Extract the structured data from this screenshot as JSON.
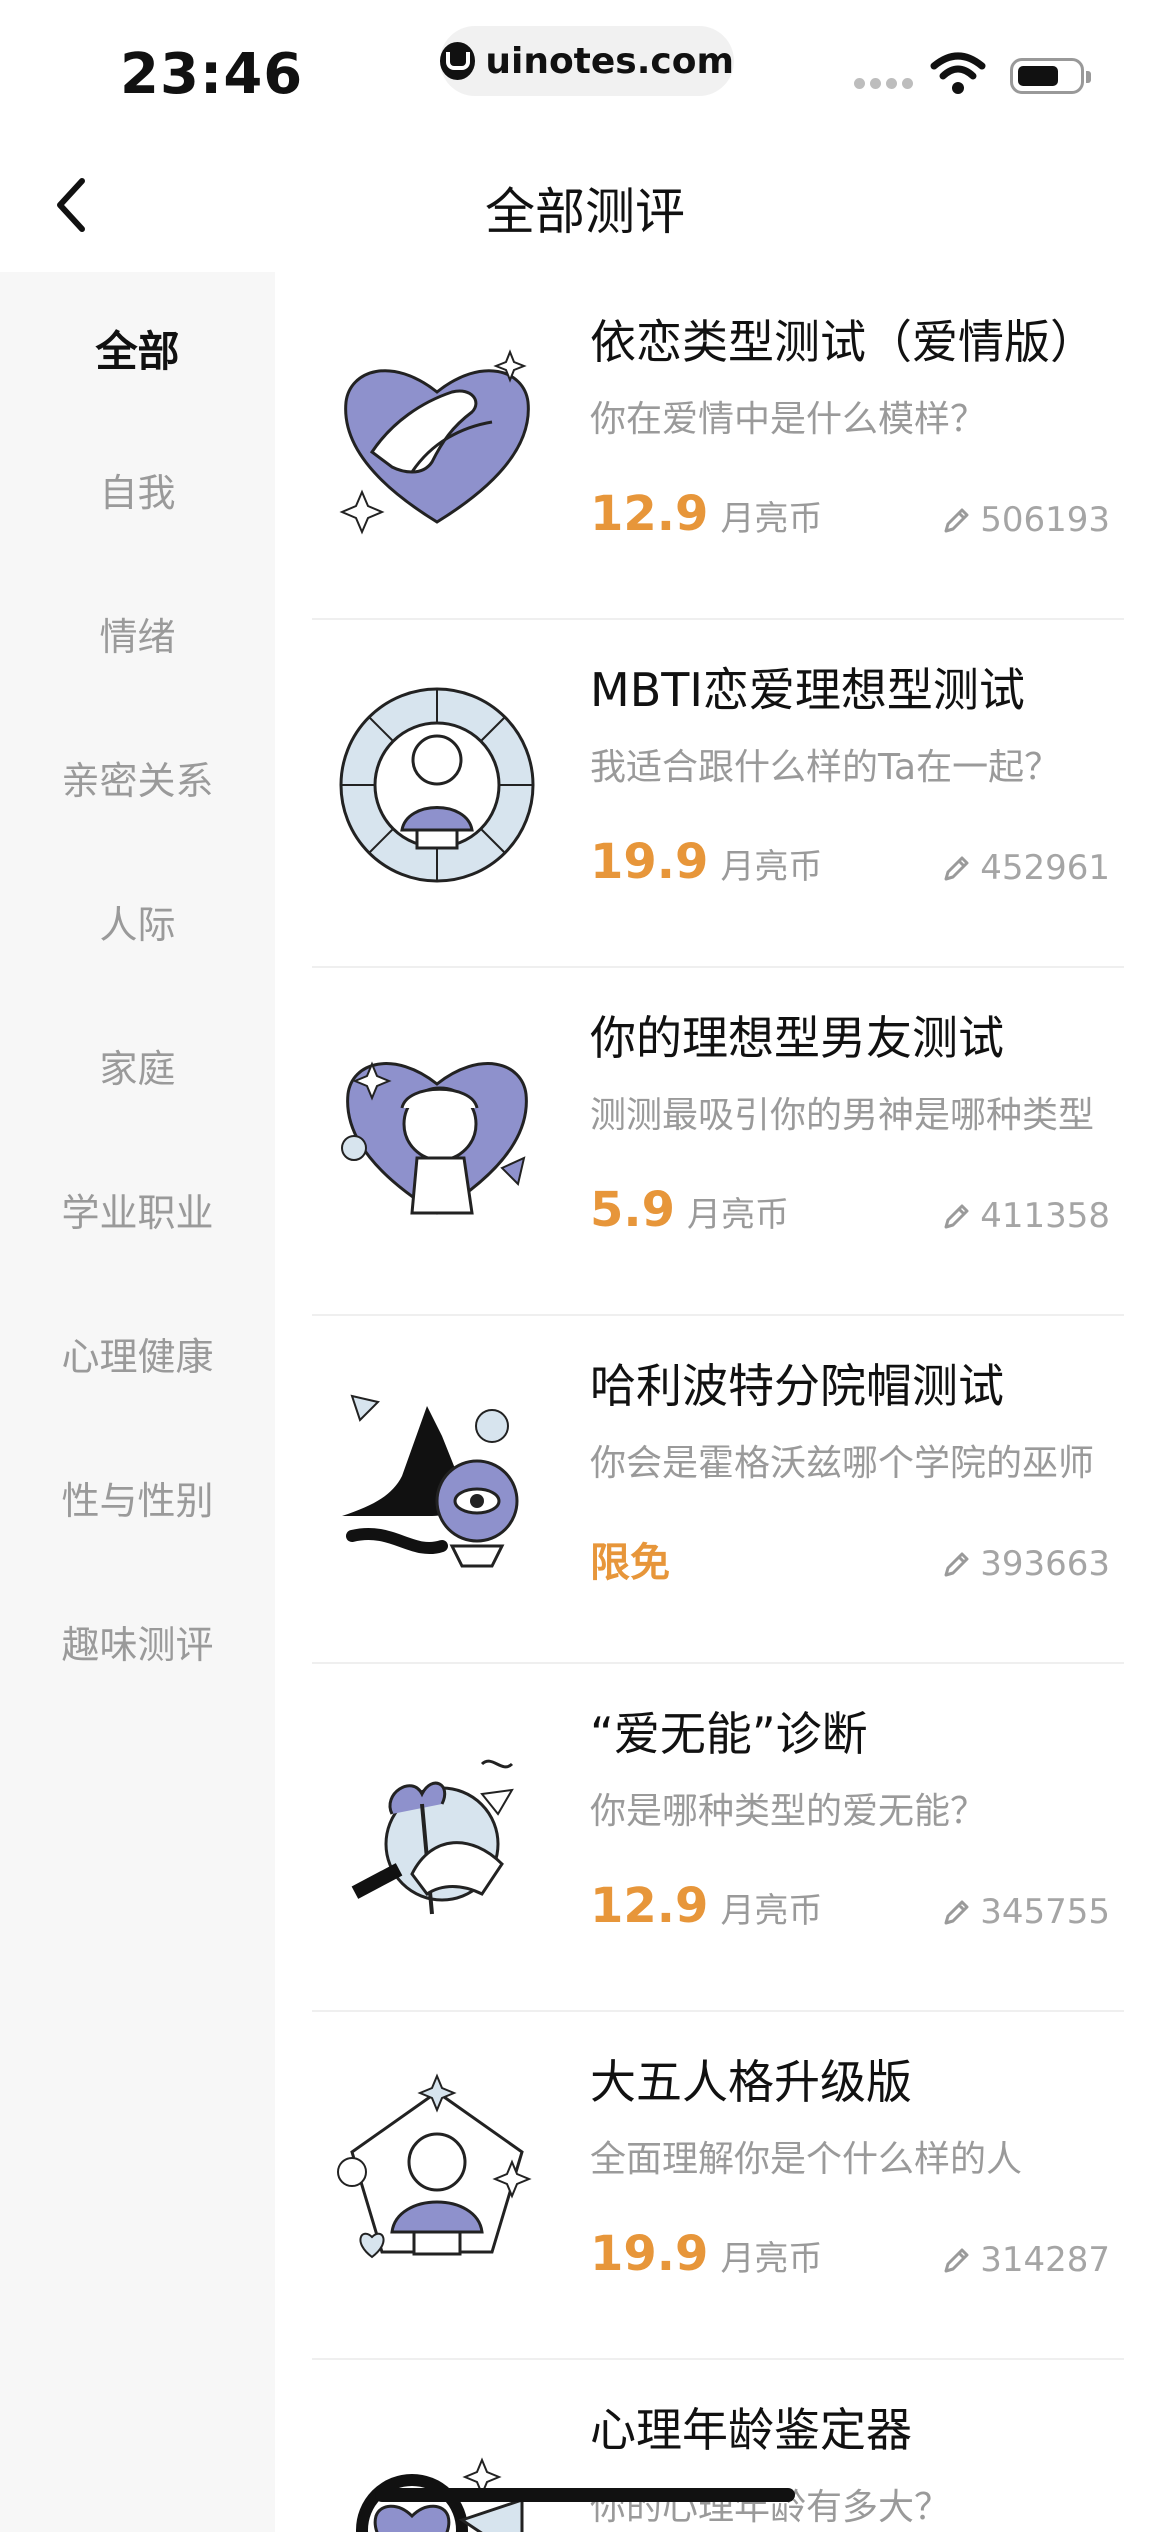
{
  "status_bar": {
    "time": "23:46",
    "url": "uinotes.com"
  },
  "nav": {
    "title": "全部测评"
  },
  "sidebar": {
    "items": [
      {
        "label": "全部",
        "active": true
      },
      {
        "label": "自我"
      },
      {
        "label": "情绪"
      },
      {
        "label": "亲密关系"
      },
      {
        "label": "人际"
      },
      {
        "label": "家庭"
      },
      {
        "label": "学业职业"
      },
      {
        "label": "心理健康"
      },
      {
        "label": "性与性别"
      },
      {
        "label": "趣味测评"
      }
    ]
  },
  "tests": [
    {
      "title": "依恋类型测试（爱情版）",
      "subtitle": "你在爱情中是什么模样？",
      "price": "12.9",
      "unit": "月亮币",
      "count": "506193",
      "thumb": "holding-hands-heart-icon"
    },
    {
      "title": "MBTI恋爱理想型测试",
      "subtitle": "我适合跟什么样的Ta在一起？",
      "price": "19.9",
      "unit": "月亮币",
      "count": "452961",
      "thumb": "mbti-wheel-bust-icon"
    },
    {
      "title": "你的理想型男友测试",
      "subtitle": "测测最吸引你的男神是哪种类型",
      "price": "5.9",
      "unit": "月亮币",
      "count": "411358",
      "thumb": "statue-heart-icon"
    },
    {
      "title": "哈利波特分院帽测试",
      "subtitle": "你会是霍格沃兹哪个学院的巫师",
      "free_label": "限免",
      "count": "393663",
      "thumb": "sorting-hat-crystal-ball-icon"
    },
    {
      "title": "“爱无能”诊断",
      "subtitle": "你是哪种类型的爱无能？",
      "price": "12.9",
      "unit": "月亮币",
      "count": "345755",
      "thumb": "hand-flower-icon"
    },
    {
      "title": "大五人格升级版",
      "subtitle": "全面理解你是个什么样的人",
      "price": "19.9",
      "unit": "月亮币",
      "count": "314287",
      "thumb": "pentagon-bust-icon"
    },
    {
      "title": "心理年龄鉴定器",
      "subtitle": "你的心理年龄有多大？",
      "thumb": "heart-rings-icon"
    }
  ],
  "colors": {
    "accent": "#e7963a",
    "illustration": "#8e91cc",
    "sidebar_bg": "#f7f7f7"
  }
}
